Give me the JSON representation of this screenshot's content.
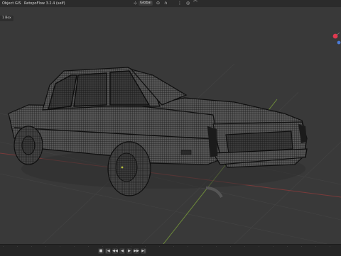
{
  "header": {
    "mode": "Object",
    "gis_label": "GIS",
    "addon_label": "RetopoFlow 3.2.4 (self)",
    "transform_orientation": "Global"
  },
  "viewport": {
    "mode_chip": "1 Box"
  },
  "icons": {
    "transform_orientation": "axes-icon",
    "pivot": "pivot-icon",
    "snap": "magnet-icon",
    "proportional": "proportional-edit-icon",
    "gizmo_x": "x-axis-handle",
    "gizmo_y": "y-axis-handle"
  },
  "colors": {
    "gizmo_red": "#e0394f",
    "gizmo_blue": "#4a7bd8",
    "axis_red": "#7a3a3a",
    "axis_green": "#6d8a3a",
    "wire": "#111111"
  },
  "timeline": {
    "transport": [
      "■",
      "|◀",
      "◀◀",
      "◀",
      "▶",
      "▶▶",
      "▶|"
    ]
  }
}
